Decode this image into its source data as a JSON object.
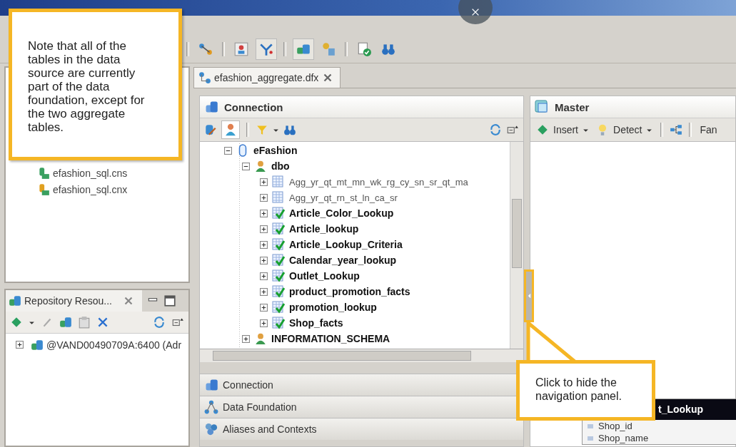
{
  "left_panel": {
    "items": [
      {
        "label": "efashion_sql.cns",
        "kind": "cns"
      },
      {
        "label": "efashion_sql.cnx",
        "kind": "cnx"
      }
    ]
  },
  "repository_panel": {
    "tab": "Repository Resou...",
    "items": [
      {
        "label": "@VAND00490709A:6400 (Adr",
        "expanded": false
      }
    ]
  },
  "editor_tab": {
    "label": "efashion_aggregate.dfx",
    "selected": true
  },
  "connection_panel": {
    "title": "Connection",
    "tree": {
      "label": "eFashion",
      "expanded": true,
      "children": [
        {
          "label": "dbo",
          "expanded": true,
          "children": [
            {
              "label": "Agg_yr_qt_mt_mn_wk_rg_cy_sn_sr_qt_ma",
              "included": false
            },
            {
              "label": "Agg_yr_qt_rn_st_ln_ca_sr",
              "included": false
            },
            {
              "label": "Article_Color_Lookup",
              "included": true
            },
            {
              "label": "Article_lookup",
              "included": true
            },
            {
              "label": "Article_Lookup_Criteria",
              "included": true
            },
            {
              "label": "Calendar_year_lookup",
              "included": true
            },
            {
              "label": "Outlet_Lookup",
              "included": true
            },
            {
              "label": "product_promotion_facts",
              "included": true
            },
            {
              "label": "promotion_lookup",
              "included": true
            },
            {
              "label": "Shop_facts",
              "included": true
            }
          ]
        },
        {
          "label": "INFORMATION_SCHEMA",
          "expanded": false
        }
      ]
    }
  },
  "navigator": [
    {
      "label": "Connection",
      "kind": "connection"
    },
    {
      "label": "Data Foundation",
      "kind": "foundation"
    },
    {
      "label": "Aliases and Contexts",
      "kind": "aliases"
    }
  ],
  "master_panel": {
    "title": "Master",
    "toolbar": [
      {
        "label": "Insert",
        "kind": "insert"
      },
      {
        "label": "Detect",
        "kind": "detect"
      },
      {
        "label": "Fan",
        "kind": "text"
      }
    ],
    "table": {
      "title": "t_Lookup",
      "columns": [
        "Shop_id",
        "Shop_name"
      ]
    }
  },
  "callouts": [
    {
      "text": "Note that all of the tables in the data source are currently part of the data foundation, except for the two aggregate tables.",
      "kind": "box"
    },
    {
      "text": "Click to hide the navigation panel.",
      "kind": "pointer"
    }
  ]
}
